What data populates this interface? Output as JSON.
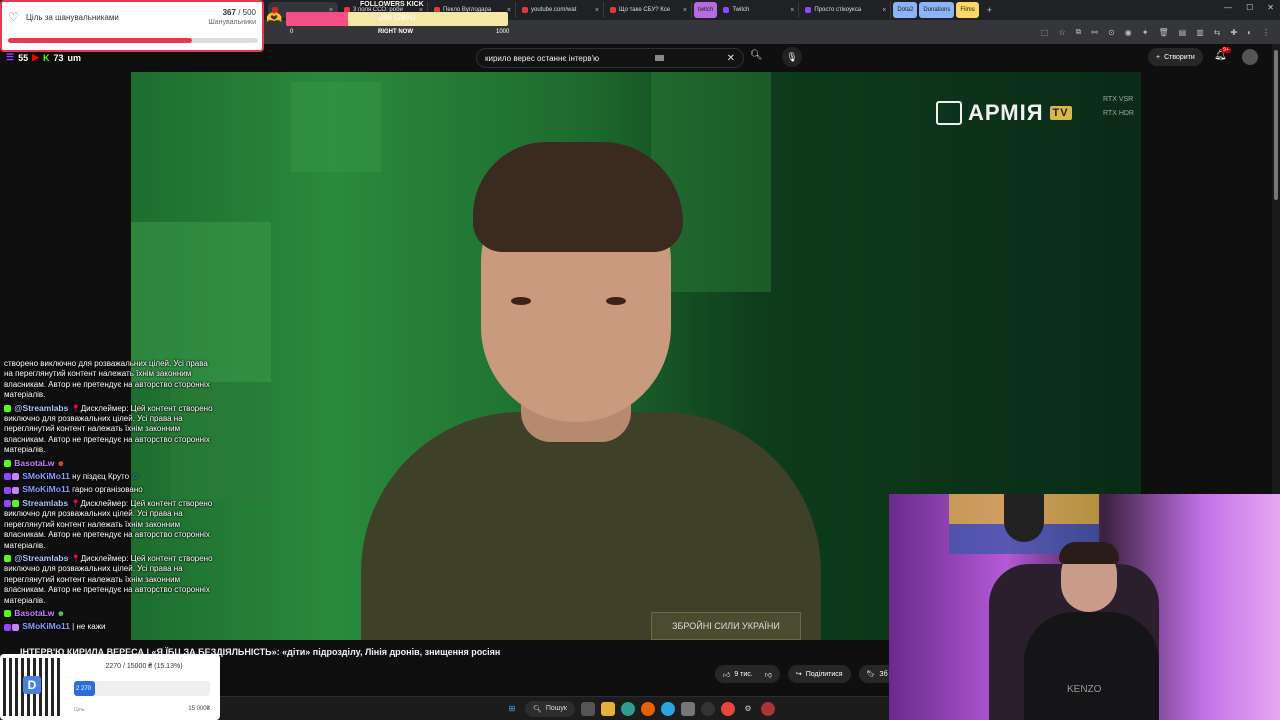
{
  "browser": {
    "tabs": [
      {
        "label": "",
        "active": true
      },
      {
        "label": "3 поля ССО: роби"
      },
      {
        "label": "Пекло Вуглодара"
      },
      {
        "label": "youtube.com/wat"
      },
      {
        "label": "Що таке СБУ? Ксе"
      },
      {
        "label": "twitch"
      },
      {
        "label": "Twitch"
      },
      {
        "label": "Просто стікоукса"
      },
      {
        "label": "Dota2"
      },
      {
        "label": "Donations"
      },
      {
        "label": "Films"
      }
    ],
    "new_tab": "+"
  },
  "youtube": {
    "search_value": "кирило верес останнє інтерв'ю",
    "create_label": "Створити",
    "notif_count": "9+",
    "video_title": "ІНТЕРВ'Ю КИРИЛА ВЕРЕСА | «Я ЇБЦ ЗА БЕЗДІЯЛЬНІСТЬ»: «діти» підрозділу, Лінія дронів, знищення росіян",
    "likes": "9 тис.",
    "share_label": "Поділитися",
    "save_label": "Зб",
    "channel_logo": "АРМІЯ",
    "channel_logo_tv": "TV",
    "rtx_vsr": "RTX VSR",
    "rtx_hdr": "RTX HDR",
    "patch_text": "ЗБРОЙНІ СИЛИ УКРАЇНИ"
  },
  "goal_widget": {
    "title": "Ціль за шанувальниками",
    "current": "367",
    "target": "/ 500",
    "subtitle": "Шанувальники",
    "progress": 0.734,
    "color": "#e53950"
  },
  "kick_widget": {
    "label": "FOLLOWERS KICK",
    "value": "289 (28%)",
    "min": "0",
    "now": "RIGHT NOW",
    "max": "1000",
    "progress": 0.28
  },
  "viewers": {
    "youtube": "55",
    "kick": "73",
    "extra": "um"
  },
  "chat": [
    {
      "name": "",
      "text": "створено виключно для розважальних цілей. Усі права на переглянутий контент належать їхнім законним власникам. Автор не претендує на авторство сторонніх матеріалів.",
      "color": "#ffffff"
    },
    {
      "name": "@Streamlabs",
      "text": "Дисклеймер: Цей контент створено виключно для розважальних цілей. Усі права на переглянутий контент належать їхнім законним власникам. Автор не претендує на авторство сторонніх матеріалів.",
      "color": "#a8c6ff"
    },
    {
      "name": "BasotaLw",
      "text": "",
      "color": "#c882ff"
    },
    {
      "name": "SMoKiMo11",
      "text": "ну піздєц Круто",
      "color": "#8a9cff"
    },
    {
      "name": "SMoKiMo11",
      "text": "гарно організовано",
      "color": "#8a9cff"
    },
    {
      "name": "Streamlabs",
      "text": "Дисклеймер: Цей контент створено виключно для розважальних цілей. Усі права на переглянутий контент належать їхнім законним власникам. Автор не претендує на авторство сторонніх матеріалів.",
      "color": "#a8c6ff"
    },
    {
      "name": "@Streamlabs",
      "text": "Дисклеймер: Цей контент створено виключно для розважальних цілей. Усі права на переглянутий контент належать їхнім законним власникам. Автор не претендує на авторство сторонніх матеріалів.",
      "color": "#a8c6ff"
    },
    {
      "name": "BasotaLw",
      "text": "",
      "color": "#c882ff"
    },
    {
      "name": "SMoKiMo11",
      "text": "| не кажи",
      "color": "#8a9cff"
    }
  ],
  "donate_widget": {
    "text": "2270 / 15000 ₴ (15.13%)",
    "amount": "2 270",
    "label": "Ціль",
    "max": "15 000₴",
    "progress": 0.1513
  },
  "taskbar": {
    "search_label": "Пошук"
  },
  "webcam": {
    "shirt_text": "KENZO"
  }
}
